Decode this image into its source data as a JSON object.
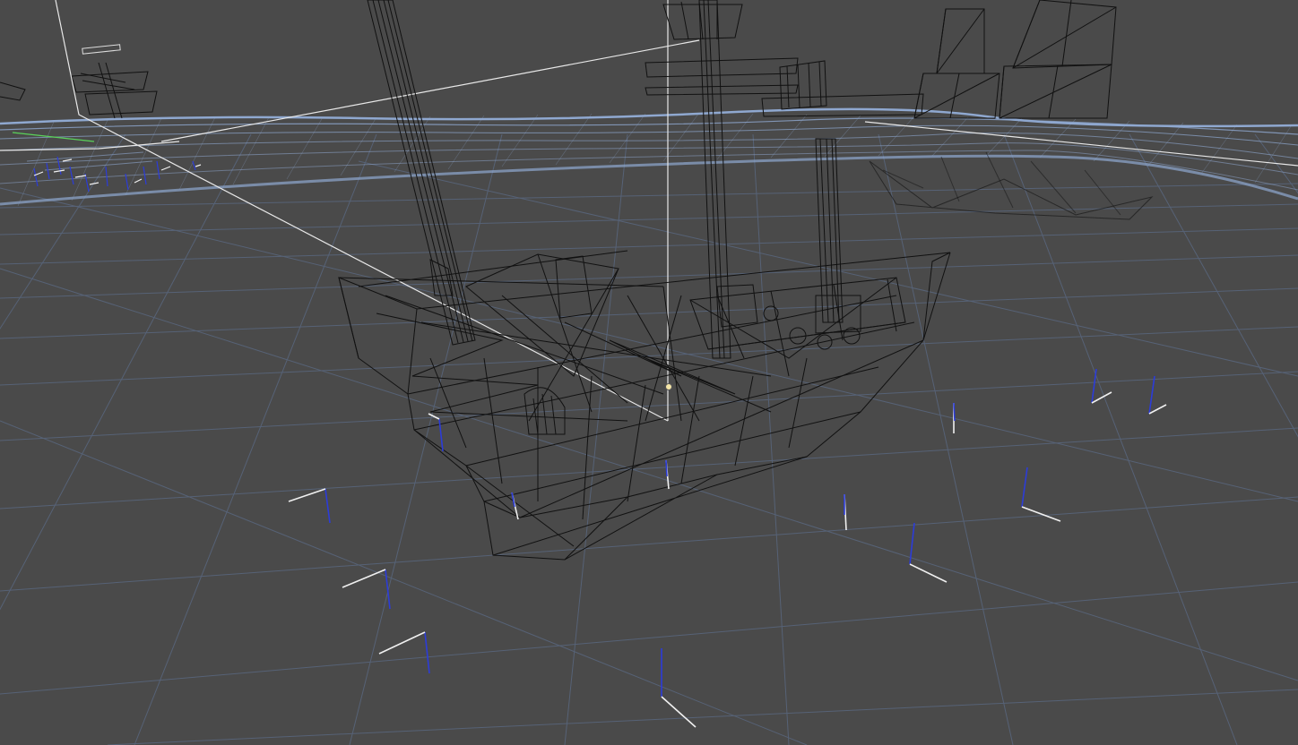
{
  "viewport": {
    "mode": "wireframe",
    "background_color": "#4a4a4a",
    "grid_color": "#5b6a85",
    "water_color": "#8fa8d0",
    "wire_color": "#111111",
    "gizmo_line_color": "#e8e8e8",
    "gizmo_axis_blue": "#2c3cd8",
    "gizmo_axis_white": "#f0f0f0",
    "gizmo_axis_green": "#5ad25a",
    "light_icon_color": "#f5e6a8",
    "icons": [
      "ship-wireframe",
      "light-gizmo",
      "object-axis-gizmo"
    ]
  }
}
